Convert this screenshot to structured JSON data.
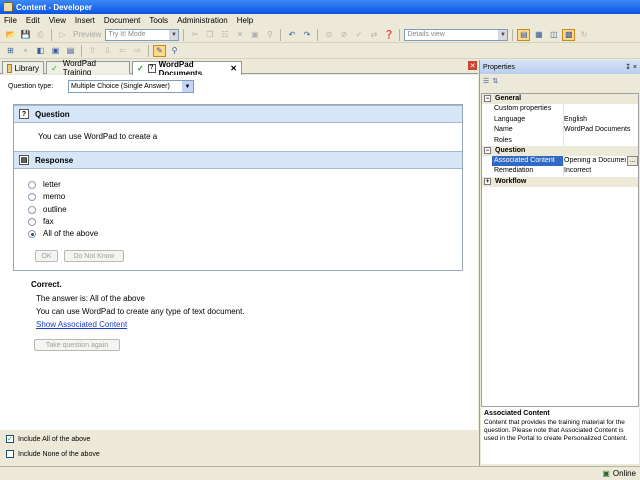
{
  "window": {
    "title": "Content - Developer"
  },
  "menu": [
    "File",
    "Edit",
    "View",
    "Insert",
    "Document",
    "Tools",
    "Administration",
    "Help"
  ],
  "toolbar": {
    "preview_label": "Preview",
    "mode_select": "Try It! Mode",
    "view_select": "Details view"
  },
  "tabs": [
    {
      "label": "Library"
    },
    {
      "label": "WordPad Training"
    },
    {
      "label": "WordPad Documents"
    }
  ],
  "question_editor": {
    "type_label": "Question type:",
    "type_value": "Multiple Choice (Single Answer)",
    "question_header": "Question",
    "question_text": "You can use WordPad to create a",
    "response_header": "Response",
    "options": [
      {
        "label": "letter",
        "selected": false
      },
      {
        "label": "memo",
        "selected": false
      },
      {
        "label": "outline",
        "selected": false
      },
      {
        "label": "fax",
        "selected": false
      },
      {
        "label": "All of the above",
        "selected": true
      }
    ],
    "ok_label": "OK",
    "dnk_label": "Do Not Know"
  },
  "feedback": {
    "title": "Correct.",
    "answer": "The answer is: All of the above",
    "explanation": "You can use WordPad to create any type of text document.",
    "link": "Show Associated Content",
    "retry_label": "Take question again"
  },
  "footer": {
    "include_all": {
      "label": "Include All of the above",
      "checked": true
    },
    "include_none": {
      "label": "Include None of the above",
      "checked": false
    }
  },
  "properties": {
    "title": "Properties",
    "pin": "↧ ×",
    "categories": [
      {
        "name": "General",
        "expanded": true,
        "rows": [
          {
            "key": "Custom properties",
            "value": ""
          },
          {
            "key": "Language",
            "value": "English"
          },
          {
            "key": "Name",
            "value": "WordPad Documents"
          },
          {
            "key": "Roles",
            "value": ""
          }
        ]
      },
      {
        "name": "Question",
        "expanded": true,
        "rows": [
          {
            "key": "Associated Content",
            "value": "Opening a Document"
          },
          {
            "key": "Remediation",
            "value": "Incorrect"
          }
        ]
      },
      {
        "name": "Workflow",
        "expanded": false,
        "rows": []
      }
    ],
    "desc_title": "Associated Content",
    "desc_text": "Content that provides the training material for the question. Please note that Associated Content is used in the Portal to create Personalized Content."
  },
  "status": {
    "text": "Online"
  },
  "colors": {
    "title_bar": "#0a54e3",
    "section_header": "#d7e6f7",
    "selection": "#316ac5",
    "link": "#1a3ad0"
  }
}
